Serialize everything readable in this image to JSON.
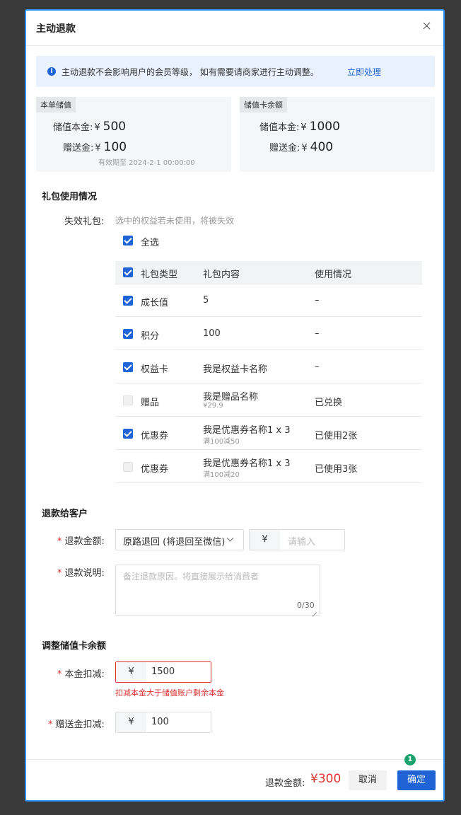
{
  "modal": {
    "title": "主动退款"
  },
  "alert": {
    "text": "主动退款不会影响用户的会员等级， 如有需要请商家进行主动调整。",
    "link": "立即处理"
  },
  "order_stored": {
    "tag": "本单储值",
    "principal_label": "储值本金:",
    "principal_currency": "¥",
    "principal_value": "500",
    "gift_label": "赠送金:",
    "gift_currency": "¥",
    "gift_value": "100",
    "expiry": "有效期至 2024-2-1 00:00:00"
  },
  "card_balance": {
    "tag": "储值卡余额",
    "principal_label": "储值本金:",
    "principal_currency": "¥",
    "principal_value": "1000",
    "gift_label": "赠送金:",
    "gift_currency": "¥",
    "gift_value": "400"
  },
  "gift_section": {
    "title": "礼包使用情况",
    "invalid_label": "失效礼包:",
    "invalid_hint": "选中的权益若未使用，将被失效",
    "select_all": "全选",
    "columns": [
      "礼包类型",
      "礼包内容",
      "使用情况"
    ],
    "rows": [
      {
        "type": "成长值",
        "content": "5",
        "sub": "",
        "usage": "–",
        "checked": true
      },
      {
        "type": "积分",
        "content": "100",
        "sub": "",
        "usage": "–",
        "checked": true
      },
      {
        "type": "权益卡",
        "content": "我是权益卡名称",
        "sub": "",
        "usage": "–",
        "checked": true
      },
      {
        "type": "赠品",
        "content": "我是赠品名称",
        "sub": "¥29.9",
        "usage": "已兑换",
        "checked": false
      },
      {
        "type": "优惠券",
        "content": "我是优惠券名称1  x 3",
        "sub": "满100减50",
        "usage": "已使用2张",
        "checked": true
      },
      {
        "type": "优惠券",
        "content": "我是优惠券名称1  x 3",
        "sub": "满100减20",
        "usage": "已使用3张",
        "checked": false
      }
    ]
  },
  "refund_section": {
    "title": "退款给客户",
    "required_mark": "*",
    "amount_label": "退款金额:",
    "method_selected": "原路退回 (将退回至微信)",
    "currency": "¥",
    "amount_placeholder": "请输入",
    "note_label": "退款说明:",
    "note_placeholder": "备注退款原因。将直接展示给消费者",
    "note_counter": "0/30"
  },
  "adjust_section": {
    "title": "调整储值卡余额",
    "principal_label": "本金扣减:",
    "principal_currency": "¥",
    "principal_value": "1500",
    "principal_error": "扣减本金大于储值账户剩余本金",
    "gift_label": "赠送金扣减:",
    "gift_currency": "¥",
    "gift_value": "100"
  },
  "footer": {
    "total_label": "退款金额:",
    "total_value": "¥300",
    "cancel": "取消",
    "confirm": "确定",
    "badge": "1"
  },
  "colors": {
    "primary": "#1f63d6",
    "error": "#e03131",
    "badge": "#1aa36e",
    "frame": "#2f8ff5"
  }
}
